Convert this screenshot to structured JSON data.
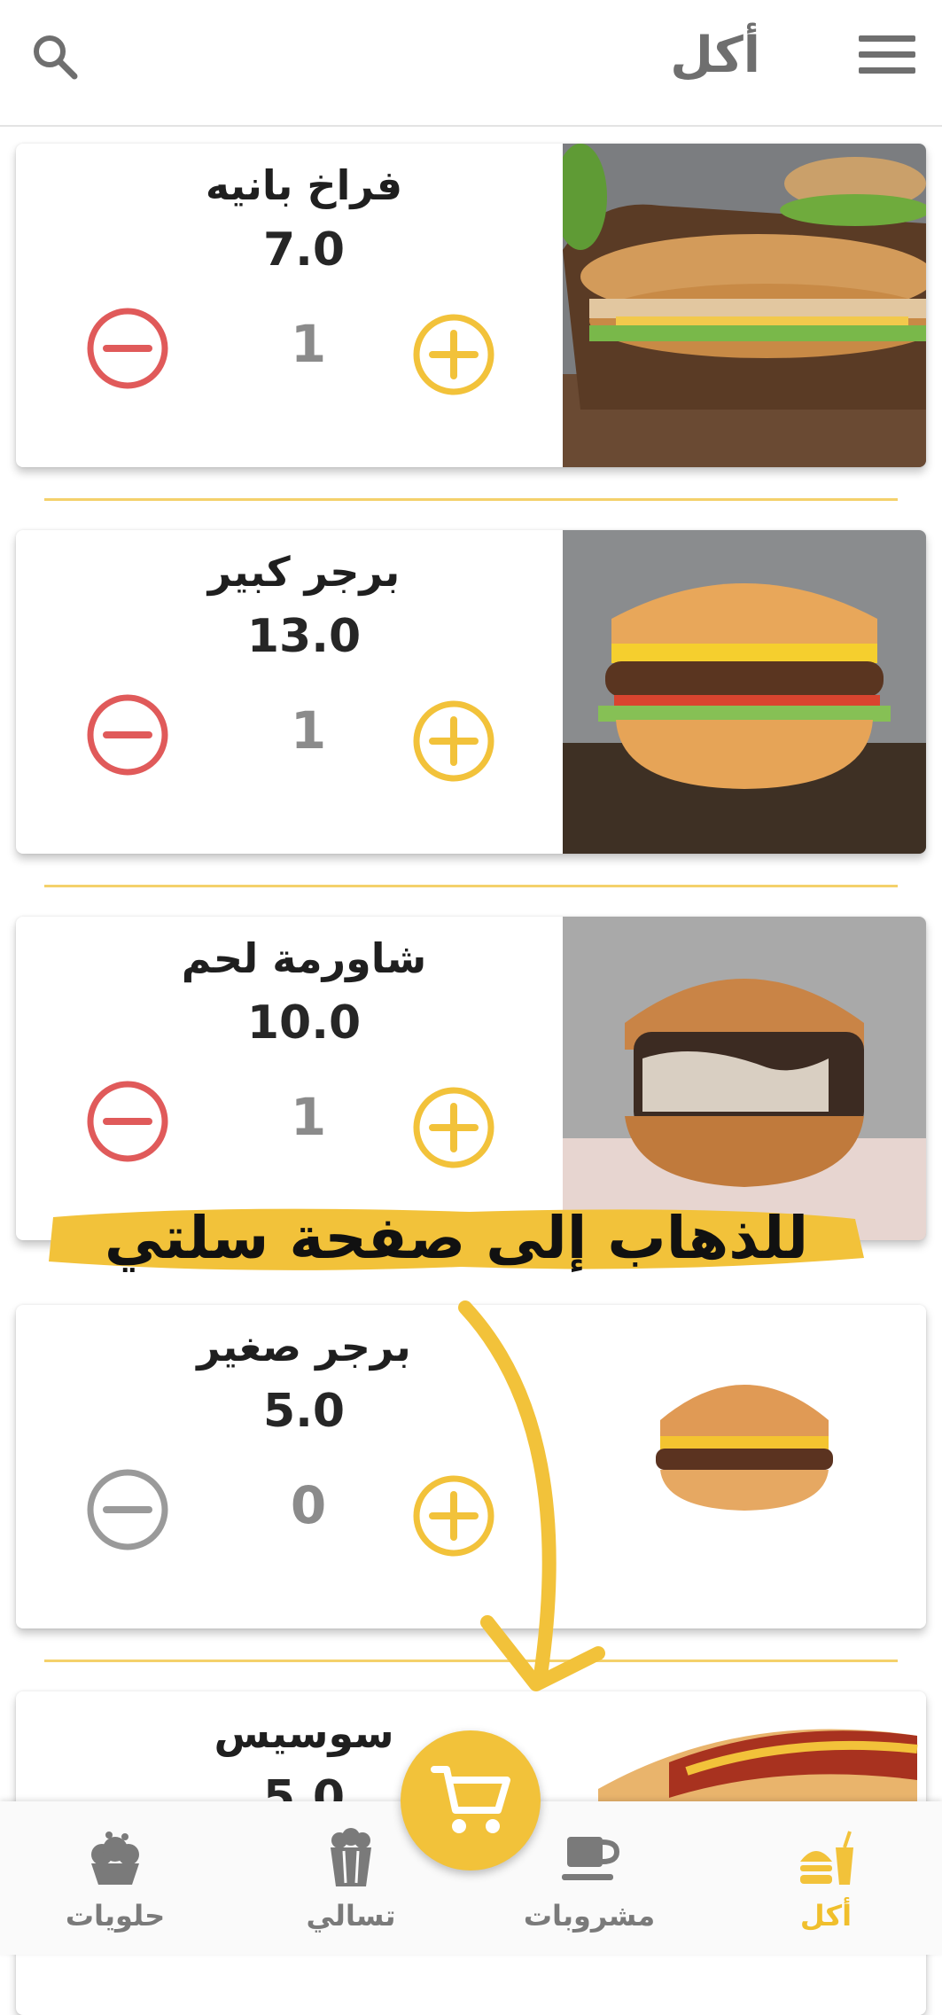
{
  "appbar": {
    "title": "أكل"
  },
  "products": [
    {
      "name": "فراخ بانيه",
      "price": "7.0",
      "qty": "1"
    },
    {
      "name": "برجر كبير",
      "price": "13.0",
      "qty": "1"
    },
    {
      "name": "شاورمة لحم",
      "price": "10.0",
      "qty": "1"
    },
    {
      "name": "برجر صغير",
      "price": "5.0",
      "qty": "0"
    },
    {
      "name": "سوسيس",
      "price": "5.0",
      "qty": ""
    }
  ],
  "annotation": {
    "text": "للذهاب إلى صفحة سلتي"
  },
  "nav": {
    "items": [
      {
        "label": "حلويات",
        "icon": "cupcake-icon"
      },
      {
        "label": "تسالي",
        "icon": "popcorn-icon"
      },
      {
        "label": "مشروبات",
        "icon": "cup-icon"
      },
      {
        "label": "أكل",
        "icon": "burger-drink-icon",
        "active": true
      }
    ],
    "cart_icon": "cart-icon"
  },
  "colors": {
    "accent": "#f2c23a",
    "minus_active": "#e05a5a",
    "minus_disabled": "#9a9a9a",
    "plus": "#f2c23a"
  }
}
